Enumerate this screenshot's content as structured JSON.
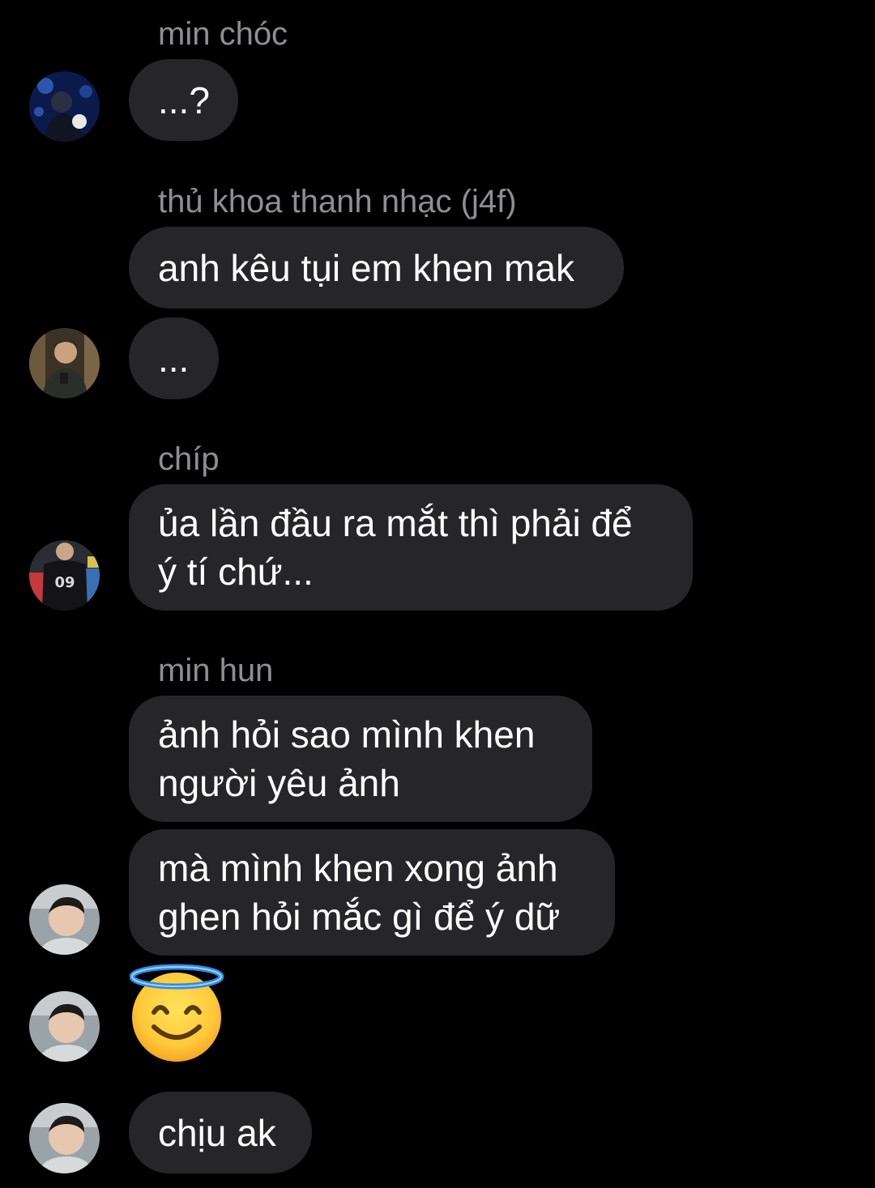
{
  "messages": [
    {
      "sender": "min chóc",
      "lines": [
        "...?"
      ]
    },
    {
      "sender": "thủ khoa thanh nhạc (j4f)",
      "lines": [
        "anh kêu tụi em khen mak"
      ]
    },
    {
      "lines": [
        "..."
      ]
    },
    {
      "sender": "chíp",
      "lines": [
        "ủa lần đầu ra mắt thì phải để",
        "ý tí chứ..."
      ]
    },
    {
      "sender": "min hun",
      "lines": [
        "ảnh hỏi sao mình khen",
        "người yêu ảnh"
      ]
    },
    {
      "lines": [
        "mà mình khen xong ảnh",
        "ghen hỏi mắc gì để ý dữ"
      ]
    },
    {
      "emoji": "smiling-face-with-halo"
    },
    {
      "lines": [
        "chịu ak"
      ]
    }
  ],
  "colors": {
    "background": "#000000",
    "bubble": "#262628",
    "sender_name": "#8e8e93",
    "text": "#ffffff"
  }
}
